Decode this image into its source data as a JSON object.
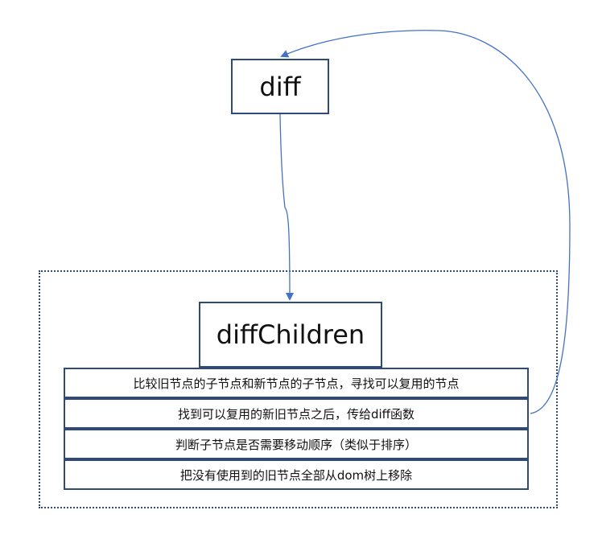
{
  "diagram": {
    "root_label": "diff",
    "child_label": "diffChildren",
    "steps": [
      "比较旧节点的子节点和新节点的子节点，寻找可以复用的节点",
      "找到可以复用的新旧节点之后，传给diff函数",
      "判断子节点是否需要移动顺序（类似于排序）",
      "把没有使用到的旧节点全部从dom树上移除"
    ]
  },
  "colors": {
    "border": "#2f4a78",
    "arrow": "#4472c4",
    "text": "#111111",
    "background": "#ffffff"
  }
}
